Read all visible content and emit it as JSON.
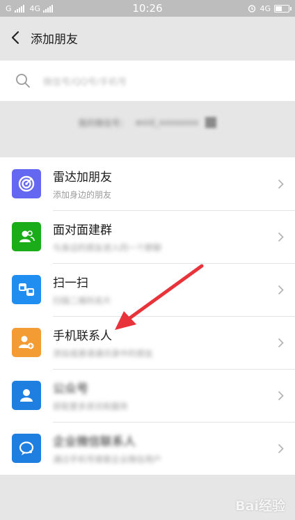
{
  "status_bar": {
    "sim1": "G",
    "sim2": "4G",
    "time": "10:26",
    "network_right": "4G"
  },
  "nav": {
    "title": "添加朋友",
    "back_icon": "chevron-left-icon"
  },
  "search": {
    "placeholder": "微信号/QQ号/手机号",
    "icon": "search-icon"
  },
  "my_id": {
    "label": "我的微信号：",
    "value": "wxid_xxxxxxxx"
  },
  "items": [
    {
      "title": "雷达加朋友",
      "subtitle": "添加身边的朋友",
      "icon": "radar-icon",
      "color": "#6467ef",
      "blurred_title": false,
      "blurred_sub": false
    },
    {
      "title": "面对面建群",
      "subtitle": "与身边的朋友进入同一个群聊",
      "icon": "group-icon",
      "color": "#1aad19",
      "blurred_title": false,
      "blurred_sub": true
    },
    {
      "title": "扫一扫",
      "subtitle": "扫描二维码名片",
      "icon": "scan-icon",
      "color": "#1f8ef0",
      "blurred_title": false,
      "blurred_sub": true
    },
    {
      "title": "手机联系人",
      "subtitle": "添加或邀请通讯录中的朋友",
      "icon": "contact-add-icon",
      "color": "#f39c33",
      "blurred_title": false,
      "blurred_sub": true
    },
    {
      "title": "公众号",
      "subtitle": "获取更多资讯和服务",
      "icon": "person-icon",
      "color": "#1f7fe0",
      "blurred_title": true,
      "blurred_sub": true
    },
    {
      "title": "企业微信联系人",
      "subtitle": "通过手机号搜索企业微信用户",
      "icon": "chat-icon",
      "color": "#1f7fe0",
      "blurred_title": true,
      "blurred_sub": true
    }
  ],
  "watermark": "Bai经验",
  "colors": {
    "arrow": "#e8333a",
    "background": "#e6e6e6"
  }
}
